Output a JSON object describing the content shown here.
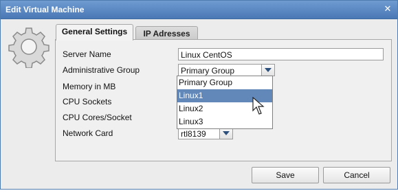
{
  "window": {
    "title": "Edit Virtual Machine",
    "close_glyph": "✕"
  },
  "tabs": [
    {
      "label": "General Settings",
      "active": true
    },
    {
      "label": "IP Adresses",
      "active": false
    }
  ],
  "form": {
    "server_name": {
      "label": "Server Name",
      "value": "Linux CentOS"
    },
    "admin_group": {
      "label": "Administrative Group",
      "value": "Primary Group"
    },
    "memory": {
      "label": "Memory in MB"
    },
    "cpu_sockets": {
      "label": "CPU Sockets"
    },
    "cpu_cores": {
      "label": "CPU Cores/Socket"
    },
    "network_card": {
      "label": "Network Card",
      "value": "rtl8139"
    }
  },
  "dropdown": {
    "options": [
      "Primary Group",
      "Linux1",
      "Linux2",
      "Linux3"
    ],
    "highlighted": "Linux1"
  },
  "buttons": {
    "save": "Save",
    "cancel": "Cancel"
  },
  "colors": {
    "title_bar": "#4a78b5",
    "selection": "#6288b9",
    "arrow": "#2c4f7c"
  },
  "icons": {
    "gear": "gear-icon",
    "cursor": "mouse-pointer-icon"
  }
}
